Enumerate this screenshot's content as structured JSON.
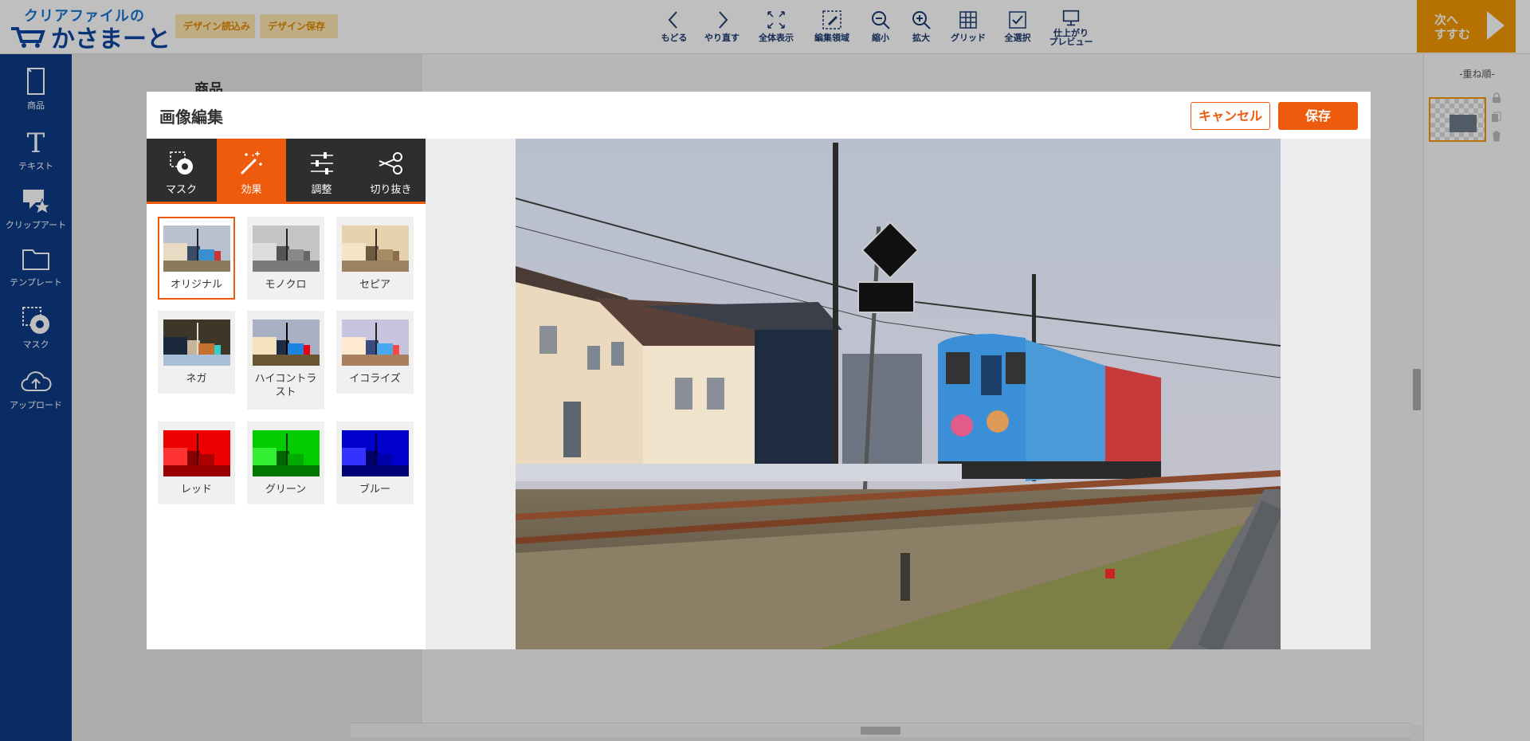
{
  "header": {
    "logo_line1": "クリアファイルの",
    "logo_line2": "かさまーと",
    "load_design": "デザイン読込み",
    "save_design": "デザイン保存",
    "tools": [
      {
        "label": "もどる",
        "icon": "undo-icon"
      },
      {
        "label": "やり直す",
        "icon": "redo-icon"
      },
      {
        "label": "全体表示",
        "icon": "fit-screen-icon"
      },
      {
        "label": "編集領域",
        "icon": "edit-area-icon"
      },
      {
        "label": "縮小",
        "icon": "zoom-out-icon"
      },
      {
        "label": "拡大",
        "icon": "zoom-in-icon"
      },
      {
        "label": "グリッド",
        "icon": "grid-icon"
      },
      {
        "label": "全選択",
        "icon": "select-all-icon"
      },
      {
        "label_line1": "仕上がり",
        "label_line2": "プレビュー",
        "icon": "monitor-icon"
      }
    ],
    "next_line1": "次へ",
    "next_line2": "すすむ"
  },
  "sidebar": {
    "items": [
      {
        "label": "商品",
        "icon": "product-icon"
      },
      {
        "label": "テキスト",
        "icon": "text-icon"
      },
      {
        "label": "クリップアート",
        "icon": "clipart-icon"
      },
      {
        "label": "テンプレート",
        "icon": "folder-icon"
      },
      {
        "label": "マスク",
        "icon": "mask-icon"
      },
      {
        "label": "アップロード",
        "icon": "upload-icon"
      }
    ]
  },
  "canvas": {
    "product_label": "商品"
  },
  "right_panel": {
    "layer_title": "-重ね順-"
  },
  "modal": {
    "title": "画像編集",
    "cancel": "キャンセル",
    "save": "保存",
    "tabs": [
      {
        "label": "マスク",
        "icon": "mask-icon"
      },
      {
        "label": "効果",
        "icon": "magic-wand-icon"
      },
      {
        "label": "調整",
        "icon": "sliders-icon"
      },
      {
        "label": "切り抜き",
        "icon": "scissors-icon"
      }
    ],
    "active_tab": "効果",
    "effects": [
      {
        "label": "オリジナル",
        "selected": true
      },
      {
        "label": "モノクロ"
      },
      {
        "label": "セピア"
      },
      {
        "label": "ネガ"
      },
      {
        "label": "ハイコントラスト"
      },
      {
        "label": "イコライズ"
      },
      {
        "label": "レッド"
      },
      {
        "label": "グリーン"
      },
      {
        "label": "ブルー"
      }
    ]
  },
  "colors": {
    "accent": "#ef5b0c",
    "brand_orange": "#f39800",
    "sidebar_blue": "#0e3b86"
  }
}
